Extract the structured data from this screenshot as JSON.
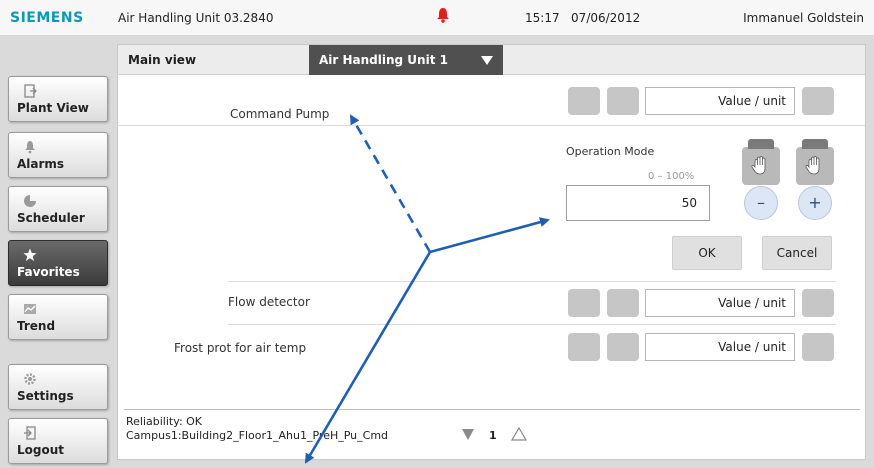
{
  "header": {
    "brand": "SIEMENS",
    "unit_title": "Air Handling Unit 03.2840",
    "time": "15:17",
    "date": "07/06/2012",
    "user": "Immanuel Goldstein",
    "alarm_icon": "bell-icon",
    "colors": {
      "brand": "#0a9ab4",
      "alarm": "#e02020"
    }
  },
  "sidebar": {
    "items": [
      {
        "label": "Plant View",
        "icon": "plant-view-icon",
        "active": false
      },
      {
        "label": "Alarms",
        "icon": "bell-icon",
        "active": false
      },
      {
        "label": "Scheduler",
        "icon": "clock-icon",
        "active": false
      },
      {
        "label": "Favorites",
        "icon": "star-icon",
        "active": true
      },
      {
        "label": "Trend",
        "icon": "trend-icon",
        "active": false
      },
      {
        "label": "Settings",
        "icon": "gear-icon",
        "active": false
      },
      {
        "label": "Logout",
        "icon": "logout-icon",
        "active": false
      }
    ]
  },
  "main": {
    "tab_label": "Main view",
    "dropdown_value": "Air Handling Unit 1",
    "rows": [
      {
        "label": "Command Pump",
        "value": "Value / unit"
      },
      {
        "label": "Flow detector",
        "value": "Value / unit"
      },
      {
        "label": "Frost prot for air temp",
        "value": "Value / unit"
      }
    ],
    "operation": {
      "title": "Operation Mode",
      "range": "0 – 100%",
      "value": "50",
      "minus": "–",
      "plus": "+",
      "ok": "OK",
      "cancel": "Cancel"
    }
  },
  "footer": {
    "reliability": "Reliability: OK",
    "path": "Campus1:Building2_Floor1_Ahu1_PreH_Pu_Cmd",
    "page": "1"
  },
  "annotation": {
    "arrow_color": "#1f5fb3"
  }
}
